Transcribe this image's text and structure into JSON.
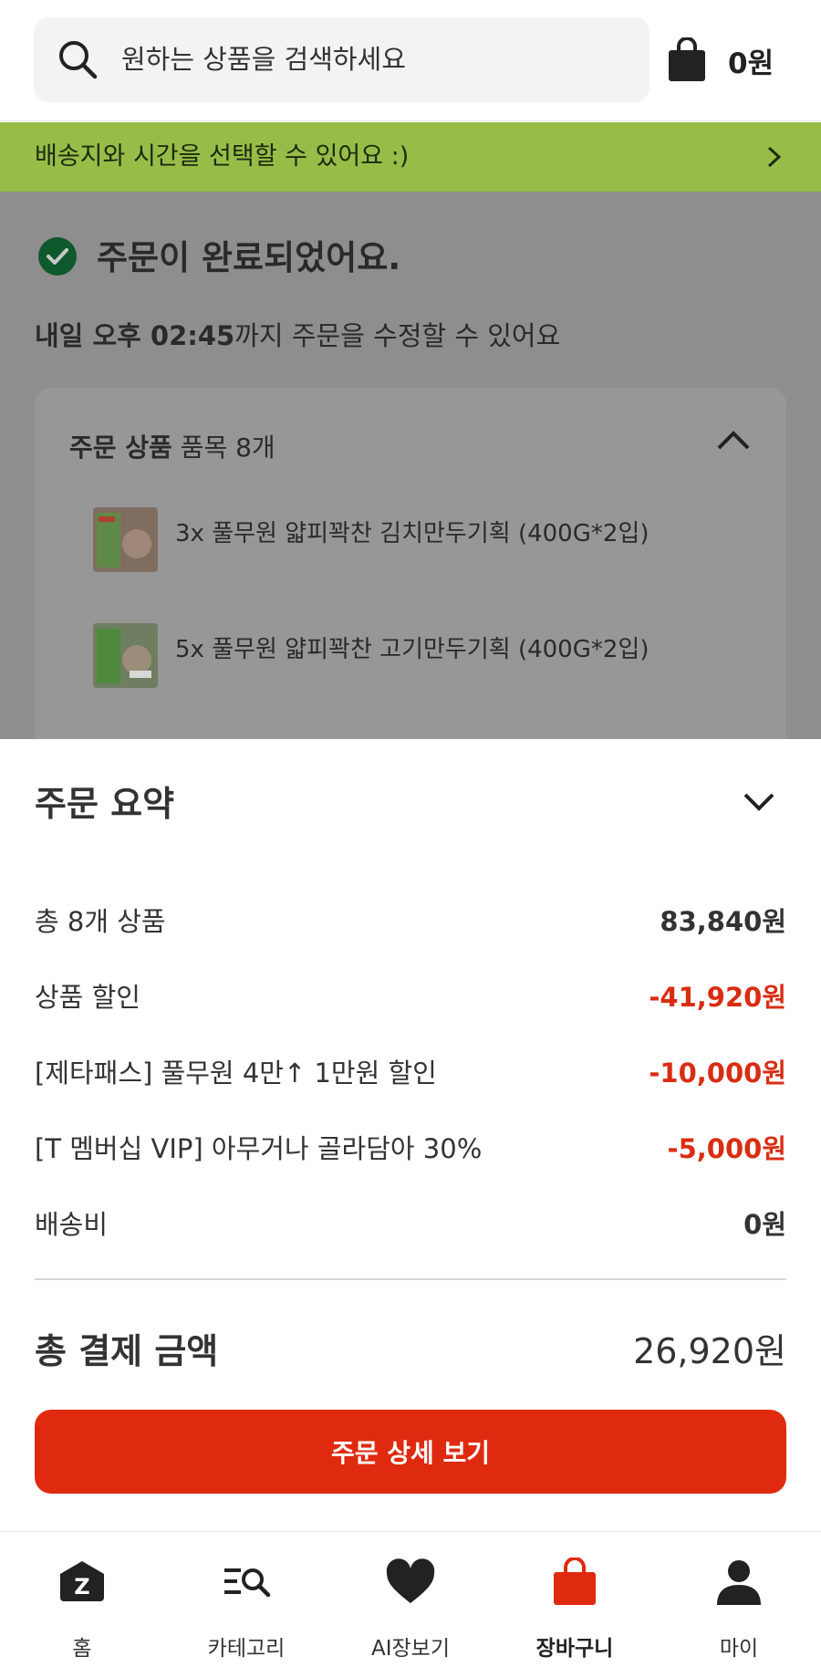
{
  "header": {
    "search_placeholder": "원하는 상품을 검색하세요",
    "cart_amount": "0원"
  },
  "banner": {
    "text": "배송지와 시간을 선택할 수 있어요 :)"
  },
  "order_status": {
    "title": "주문이 완료되었어요.",
    "edit_deadline_bold": "내일 오후 02:45",
    "edit_deadline_rest": "까지 주문을 수정할 수 있어요"
  },
  "order_items": {
    "heading_bold": "주문 상품",
    "heading_count": " 품목 8개",
    "items": [
      {
        "name": "3x 풀무원 얇피꽉찬 김치만두기획 (400G*2입)"
      },
      {
        "name": "5x 풀무원 얇피꽉찬 고기만두기획 (400G*2입)"
      }
    ]
  },
  "summary": {
    "title": "주문 요약",
    "rows": [
      {
        "label": "총 8개 상품",
        "value": "83,840원"
      },
      {
        "label": "상품 할인",
        "value": "-41,920원"
      },
      {
        "label": "[제타패스] 풀무원 4만↑ 1만원 할인",
        "value": "-10,000원"
      },
      {
        "label": "[T 멤버십 VIP] 아무거나 골라담아 30%",
        "value": "-5,000원"
      },
      {
        "label": "배송비",
        "value": "0원"
      }
    ],
    "total_label": "총 결제 금액",
    "total_value": "26,920원",
    "cta_label": "주문 상세 보기"
  },
  "nav": {
    "items": [
      {
        "label": "홈",
        "icon": "home-icon"
      },
      {
        "label": "카테고리",
        "icon": "category-search-icon"
      },
      {
        "label": "AI장보기",
        "icon": "heart-icon"
      },
      {
        "label": "장바구니",
        "icon": "shopping-bag-icon",
        "active": true
      },
      {
        "label": "마이",
        "icon": "person-icon"
      }
    ]
  },
  "colors": {
    "accent_red": "#e02a10",
    "discount_red": "#d92d12",
    "banner_green": "#97bd48",
    "success_green": "#179a4a"
  }
}
